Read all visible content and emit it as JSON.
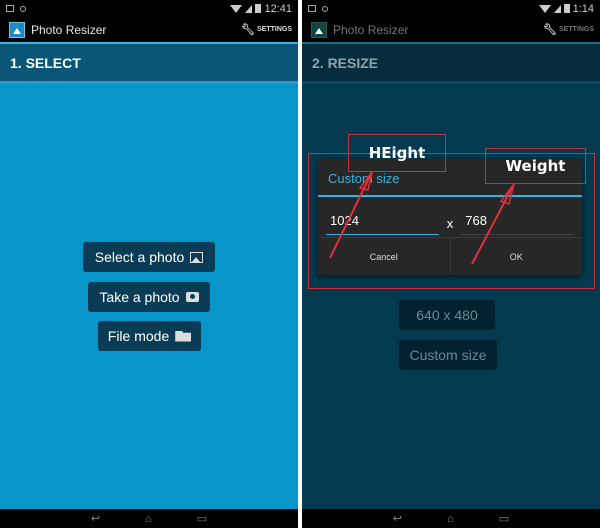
{
  "screens": [
    {
      "status": {
        "time": "12:41"
      },
      "actionbar": {
        "title": "Photo Resizer",
        "settings_label": "SETTINGS"
      },
      "header": "1. SELECT",
      "buttons": [
        {
          "label": "Select a photo",
          "icon": "image-icon"
        },
        {
          "label": "Take a photo",
          "icon": "camera-icon"
        },
        {
          "label": "File mode",
          "icon": "folder-icon"
        }
      ]
    },
    {
      "status": {
        "time": "1:14"
      },
      "actionbar": {
        "title": "Photo Resizer",
        "settings_label": "SETTINGS"
      },
      "header": "2. RESIZE",
      "background_buttons": [
        {
          "label": "640 x 480"
        },
        {
          "label": "Custom size"
        }
      ],
      "dialog": {
        "title": "Custom size",
        "width_value": "1024",
        "separator": "x",
        "height_value": "768",
        "cancel_label": "Cancel",
        "ok_label": "OK"
      },
      "annotations": {
        "left_label": "HEight",
        "right_label": "Weight",
        "color": "#c8323c"
      }
    }
  ],
  "navbar": {
    "back": "↩",
    "home": "⌂",
    "recents": "▭"
  }
}
